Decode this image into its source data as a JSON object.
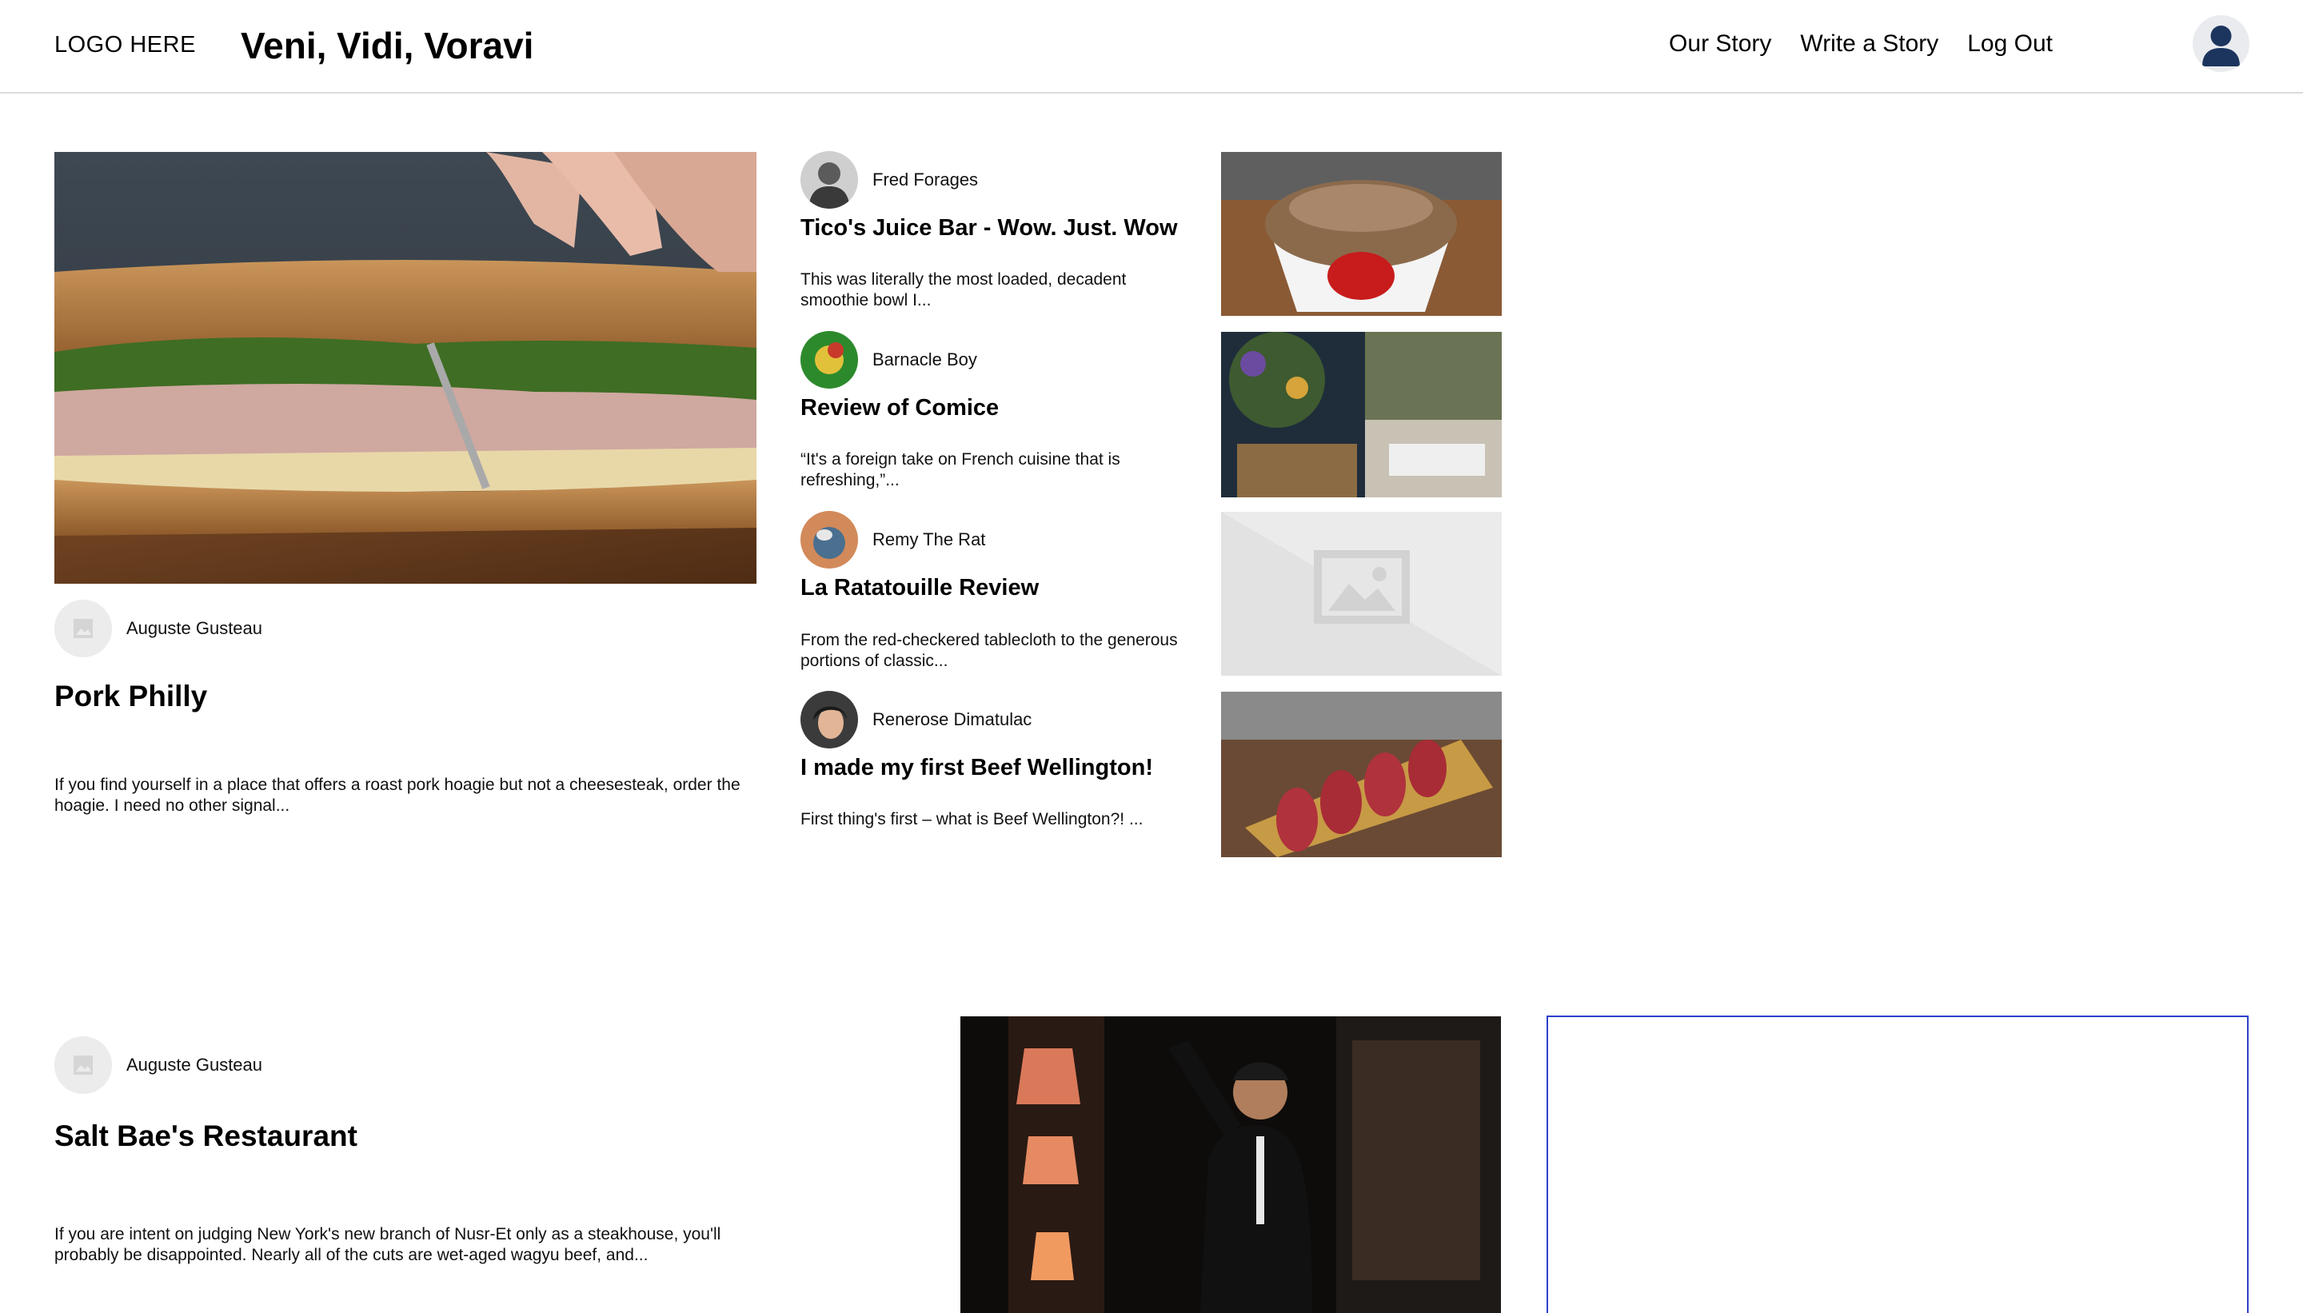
{
  "header": {
    "logo": "LOGO HERE",
    "title": "Veni, Vidi, Voravi",
    "nav": [
      {
        "label": "Our Story"
      },
      {
        "label": "Write a Story"
      },
      {
        "label": "Log Out"
      }
    ]
  },
  "featured": {
    "author": "Auguste Gusteau",
    "title": "Pork Philly",
    "excerpt": "If you find yourself in a place that offers a roast pork hoagie but not a cheesesteak, order the hoagie. I need no other signal..."
  },
  "stories": [
    {
      "author": "Fred Forages",
      "title": "Tico's Juice Bar - Wow. Just. Wow",
      "excerpt": "This was literally the most loaded, decadent smoothie bowl I..."
    },
    {
      "author": "Barnacle Boy",
      "title": "Review of Comice",
      "excerpt": "“It's a foreign take on French cuisine that is refreshing,”..."
    },
    {
      "author": "Remy The Rat",
      "title": "La Ratatouille Review",
      "excerpt": "From the red-checkered tablecloth to the generous portions of classic..."
    },
    {
      "author": "Renerose Dimatulac",
      "title": "I made my first Beef Wellington!",
      "excerpt": "First thing's first – what is Beef Wellington?! ..."
    }
  ],
  "second_featured": {
    "author": "Auguste Gusteau",
    "title": "Salt Bae's Restaurant",
    "excerpt": "If you are intent on judging New York's new branch of Nusr-Et only as a steakhouse, you'll probably be disappointed. Nearly all of the cuts are wet-aged wagyu beef, and..."
  },
  "icons": {
    "user": "user-avatar-icon",
    "placeholder": "image-placeholder-icon"
  },
  "colors": {
    "accent_border": "#2d40c9",
    "header_divider": "#dcdcdc",
    "avatar_navy": "#1c355e"
  }
}
